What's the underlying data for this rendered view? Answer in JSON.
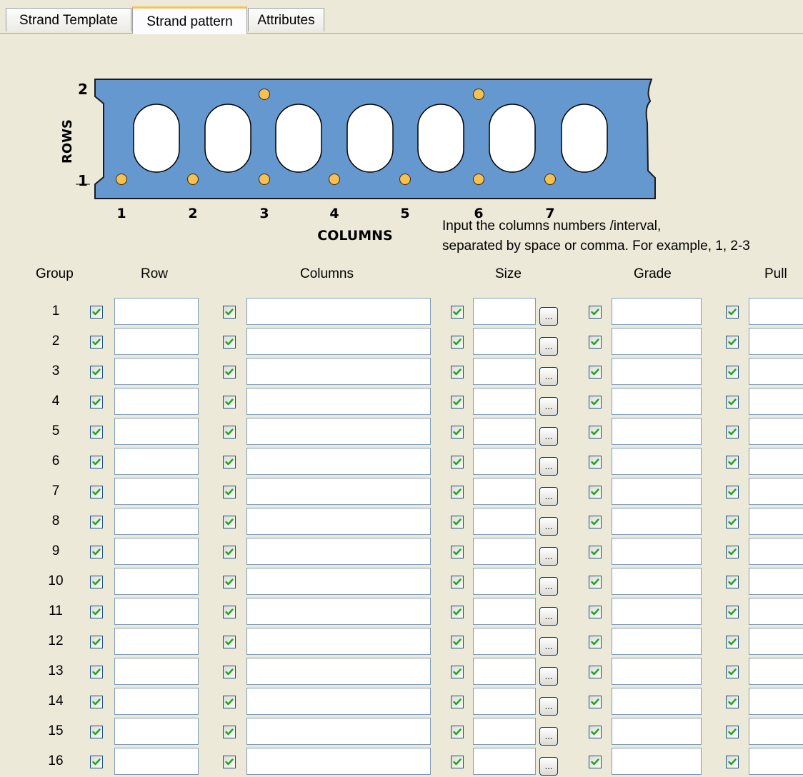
{
  "tabs": [
    {
      "label": "Strand Template",
      "active": false
    },
    {
      "label": "Strand pattern",
      "active": true
    },
    {
      "label": "Attributes",
      "active": false
    }
  ],
  "diagram": {
    "axis_rows_label": "ROWS",
    "axis_columns_label": "COLUMNS",
    "row_ticks": [
      "1",
      "2"
    ],
    "column_ticks": [
      "1",
      "2",
      "3",
      "4",
      "5",
      "6",
      "7"
    ],
    "slab_color": "#6598cf",
    "strand_color": "#f6c052",
    "bottom_strand_columns": [
      1,
      2,
      3,
      4,
      5,
      6,
      7
    ],
    "top_strand_columns": [
      3,
      6
    ]
  },
  "hint": {
    "line1": "Input the columns numbers /interval,",
    "line2": "separated by space or comma. For example, 1, 2-3"
  },
  "headers": {
    "group": "Group",
    "row": "Row",
    "columns": "Columns",
    "size": "Size",
    "grade": "Grade",
    "pull": "Pull"
  },
  "groups": [
    {
      "num": "1",
      "row": "",
      "columns": "",
      "size": "",
      "grade": "",
      "pull": ""
    },
    {
      "num": "2",
      "row": "",
      "columns": "",
      "size": "",
      "grade": "",
      "pull": ""
    },
    {
      "num": "3",
      "row": "",
      "columns": "",
      "size": "",
      "grade": "",
      "pull": ""
    },
    {
      "num": "4",
      "row": "",
      "columns": "",
      "size": "",
      "grade": "",
      "pull": ""
    },
    {
      "num": "5",
      "row": "",
      "columns": "",
      "size": "",
      "grade": "",
      "pull": ""
    },
    {
      "num": "6",
      "row": "",
      "columns": "",
      "size": "",
      "grade": "",
      "pull": ""
    },
    {
      "num": "7",
      "row": "",
      "columns": "",
      "size": "",
      "grade": "",
      "pull": ""
    },
    {
      "num": "8",
      "row": "",
      "columns": "",
      "size": "",
      "grade": "",
      "pull": ""
    },
    {
      "num": "9",
      "row": "",
      "columns": "",
      "size": "",
      "grade": "",
      "pull": ""
    },
    {
      "num": "10",
      "row": "",
      "columns": "",
      "size": "",
      "grade": "",
      "pull": ""
    },
    {
      "num": "11",
      "row": "",
      "columns": "",
      "size": "",
      "grade": "",
      "pull": ""
    },
    {
      "num": "12",
      "row": "",
      "columns": "",
      "size": "",
      "grade": "",
      "pull": ""
    },
    {
      "num": "13",
      "row": "",
      "columns": "",
      "size": "",
      "grade": "",
      "pull": ""
    },
    {
      "num": "14",
      "row": "",
      "columns": "",
      "size": "",
      "grade": "",
      "pull": ""
    },
    {
      "num": "15",
      "row": "",
      "columns": "",
      "size": "",
      "grade": "",
      "pull": ""
    },
    {
      "num": "16",
      "row": "",
      "columns": "",
      "size": "",
      "grade": "",
      "pull": ""
    }
  ],
  "size_browse_label": "...",
  "checkbox_checked": true
}
